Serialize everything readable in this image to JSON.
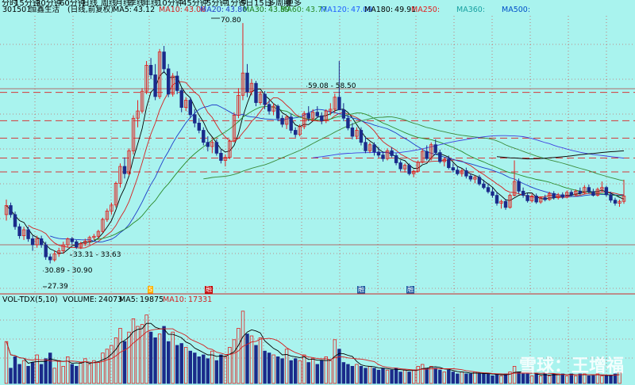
{
  "periods": [
    "分时",
    "15分钟",
    "30分钟",
    "60分钟",
    "日线",
    "周线",
    "月线",
    "季线",
    "年线",
    "10分钟",
    "45分钟",
    "5分钟",
    "1分钟",
    "5日",
    "15日",
    "多周期",
    "更多"
  ],
  "price_panel": {
    "stock_code": "301501",
    "stock_name": "恒鑫生活",
    "adjust_mode": "(日线,前复权)",
    "ma_items": [
      {
        "label": "MA5:",
        "value": "43.12",
        "color": "#000000"
      },
      {
        "label": "MA10:",
        "value": "43.06",
        "color": "#d42020"
      },
      {
        "label": "MA20:",
        "value": "43.80",
        "color": "#1e3cc8"
      },
      {
        "label": "MA30:",
        "value": "43.89",
        "color": "#1a7a1a"
      },
      {
        "label": "MA60:",
        "value": "43.77",
        "color": "#2a8a2a"
      },
      {
        "label": "MA120:",
        "value": "47.09",
        "color": "#2060ff"
      },
      {
        "label": "MA180:",
        "value": "49.91",
        "color": "#000000"
      },
      {
        "label": "MA250:",
        "value": "",
        "color": "#e02020"
      },
      {
        "label": "MA360:",
        "value": "",
        "color": "#16a0a0"
      },
      {
        "label": "MA500:",
        "value": "",
        "color": "#0050c8"
      }
    ],
    "annotations": [
      {
        "text": "70.80"
      },
      {
        "text": "59.08 - 58.50"
      },
      {
        "text": "33.31 - 33.63"
      },
      {
        "text": "30.89 - 30.90"
      },
      {
        "text": "27.39"
      }
    ],
    "event_markers": [
      {
        "text": "S",
        "color": "#ffb000"
      },
      {
        "text": "融",
        "color": "#c00000"
      },
      {
        "text": "融",
        "color": "#1a5aa0"
      },
      {
        "text": "融",
        "color": "#1a5aa0"
      }
    ]
  },
  "volume_panel": {
    "indicator": "VOL-TDX(5,10)",
    "items": [
      {
        "label": "VOLUME:",
        "value": "24073",
        "color": "#000000"
      },
      {
        "label": "MA5:",
        "value": "19875",
        "color": "#000000"
      },
      {
        "label": "MA10:",
        "value": "17331",
        "color": "#d42020"
      }
    ]
  },
  "watermark": "雪球：王增福",
  "colors": {
    "background": "#a9f3ee",
    "up": "#e0201e",
    "down": "#1a2b8a",
    "grid": "#d02828"
  },
  "chart_data": {
    "type": "candlestick",
    "price_range": [
      26.5,
      72
    ],
    "price_levels_dashed": [
      59.3,
      54.6,
      51.7,
      48.4,
      46.1
    ],
    "price_levels_solid": [
      59.9,
      34.0
    ],
    "ohlc": [
      [
        39,
        41.5,
        38,
        40.5
      ],
      [
        40.5,
        41,
        38.5,
        39
      ],
      [
        39,
        39.5,
        36.5,
        37
      ],
      [
        37,
        37.5,
        35,
        35.5
      ],
      [
        35.5,
        37,
        34.8,
        36.5
      ],
      [
        36.5,
        37,
        34.5,
        35
      ],
      [
        35,
        35.5,
        33,
        34
      ],
      [
        34,
        35.5,
        33.5,
        35
      ],
      [
        35,
        35.5,
        33.5,
        34
      ],
      [
        34,
        34.5,
        31.5,
        32
      ],
      [
        32,
        32.5,
        30.9,
        31.5
      ],
      [
        31.5,
        33,
        31.2,
        32.5
      ],
      [
        32.5,
        33.5,
        32,
        33
      ],
      [
        33,
        34.5,
        32.5,
        34
      ],
      [
        34,
        35.2,
        33.5,
        35
      ],
      [
        35,
        35.3,
        34,
        34.5
      ],
      [
        34.5,
        34.8,
        33.31,
        33.63
      ],
      [
        33.6,
        34.5,
        33.3,
        34.2
      ],
      [
        34.2,
        35,
        33.8,
        34.6
      ],
      [
        34.6,
        35.5,
        34,
        35.2
      ],
      [
        35.2,
        35.8,
        34.8,
        35.4
      ],
      [
        35.4,
        36.5,
        35,
        36.2
      ],
      [
        36.2,
        38.5,
        36,
        38.2
      ],
      [
        38.2,
        40,
        37.8,
        39.6
      ],
      [
        39.6,
        41,
        39,
        40.6
      ],
      [
        40.6,
        44.5,
        40.2,
        44.2
      ],
      [
        44.2,
        47.5,
        43.5,
        47
      ],
      [
        47,
        48.5,
        45,
        45.8
      ],
      [
        45.8,
        50,
        45.5,
        49.6
      ],
      [
        49.6,
        55.5,
        49,
        55
      ],
      [
        55,
        58,
        53.5,
        56.2
      ],
      [
        56.2,
        60,
        55.8,
        59.5
      ],
      [
        59.5,
        64.5,
        59,
        63.8
      ],
      [
        63.8,
        65,
        61.5,
        62.2
      ],
      [
        62.2,
        64,
        58,
        58.6
      ],
      [
        58.6,
        66.5,
        58.2,
        66
      ],
      [
        66,
        67,
        62.5,
        63.2
      ],
      [
        63.2,
        64,
        58.5,
        59
      ],
      [
        59,
        62.5,
        58.6,
        62
      ],
      [
        62,
        62.8,
        59,
        59.6
      ],
      [
        59.6,
        60,
        56,
        56.8
      ],
      [
        56.8,
        58.5,
        56.2,
        58
      ],
      [
        58,
        58.5,
        55,
        55.6
      ],
      [
        55.6,
        56.5,
        53.5,
        54.2
      ],
      [
        54.2,
        55,
        52.5,
        53
      ],
      [
        53,
        53.5,
        50.5,
        51
      ],
      [
        51,
        52,
        49.5,
        50.3
      ],
      [
        50.3,
        51.5,
        49.2,
        51
      ],
      [
        51,
        51.5,
        48.8,
        49.2
      ],
      [
        49.2,
        49.8,
        47.5,
        48
      ],
      [
        48,
        49,
        47,
        48.5
      ],
      [
        48.5,
        51.5,
        48.2,
        51.2
      ],
      [
        51.2,
        56,
        51,
        55.5
      ],
      [
        55.5,
        60,
        55,
        58.8
      ],
      [
        58.8,
        70.8,
        58,
        62.5
      ],
      [
        62.5,
        64,
        58.5,
        59.4
      ],
      [
        59.4,
        61.5,
        58.8,
        60.8
      ],
      [
        60.8,
        61.2,
        57,
        57.6
      ],
      [
        57.6,
        59.5,
        57.2,
        59
      ],
      [
        59,
        59.5,
        56.5,
        57.3
      ],
      [
        57.3,
        58,
        55.6,
        56.2
      ],
      [
        56.2,
        57.5,
        55.5,
        57
      ],
      [
        57,
        57.3,
        54.5,
        55
      ],
      [
        55,
        55.5,
        53.5,
        54
      ],
      [
        54,
        55.5,
        53.2,
        55.2
      ],
      [
        55.2,
        55.8,
        52.5,
        53
      ],
      [
        53,
        53.5,
        51.8,
        52.3
      ],
      [
        52.3,
        54,
        52,
        53.6
      ],
      [
        53.6,
        56.2,
        53.2,
        55.8
      ],
      [
        55.8,
        57,
        54.5,
        55
      ],
      [
        55,
        56.5,
        54.5,
        56
      ],
      [
        56,
        57,
        55,
        55.4
      ],
      [
        55.4,
        56,
        54,
        54.6
      ],
      [
        54.6,
        56.5,
        54.2,
        56.2
      ],
      [
        56.2,
        57.5,
        55.5,
        56.5
      ],
      [
        56.5,
        59.08,
        55.8,
        58.5
      ],
      [
        58.5,
        64.5,
        58,
        56.4
      ],
      [
        56.4,
        57.5,
        54.5,
        55
      ],
      [
        55,
        55.5,
        53,
        53.4
      ],
      [
        53.4,
        54.2,
        51.5,
        52
      ],
      [
        52,
        53.5,
        51.5,
        53
      ],
      [
        53,
        53.5,
        50.5,
        51
      ],
      [
        51,
        52,
        49.2,
        49.6
      ],
      [
        49.6,
        51,
        49.2,
        50.6
      ],
      [
        50.6,
        51,
        48.8,
        49.4
      ],
      [
        49.4,
        50.2,
        48.5,
        48.9
      ],
      [
        48.9,
        49.5,
        47.8,
        48.3
      ],
      [
        48.3,
        50,
        48,
        49.6
      ],
      [
        49.6,
        50.2,
        48.5,
        48.8
      ],
      [
        48.8,
        49.2,
        47.2,
        47.6
      ],
      [
        47.6,
        48,
        46.2,
        46.6
      ],
      [
        46.6,
        47.5,
        46,
        47.2
      ],
      [
        47.2,
        47.5,
        45.5,
        45.8
      ],
      [
        45.8,
        46.5,
        45.2,
        46.2
      ],
      [
        46.2,
        48,
        46,
        47.7
      ],
      [
        47.7,
        50,
        47.5,
        49.5
      ],
      [
        49.5,
        50.5,
        48,
        48.3
      ],
      [
        48.3,
        51,
        48,
        50.6
      ],
      [
        50.6,
        51.5,
        49,
        49.3
      ],
      [
        49.3,
        49.8,
        47.5,
        47.8
      ],
      [
        47.8,
        48.5,
        47,
        48.2
      ],
      [
        48.2,
        48.8,
        46.5,
        46.8
      ],
      [
        46.8,
        47.5,
        46,
        46.4
      ],
      [
        46.4,
        47,
        45.5,
        45.8
      ],
      [
        45.8,
        46.6,
        45.3,
        46.3
      ],
      [
        46.3,
        46.8,
        45,
        45.4
      ],
      [
        45.4,
        45.8,
        44.5,
        44.9
      ],
      [
        44.9,
        45.5,
        44.2,
        45.2
      ],
      [
        45.2,
        45.6,
        43.8,
        44.1
      ],
      [
        44.1,
        44.8,
        43.2,
        43.5
      ],
      [
        43.5,
        44.2,
        42.5,
        42.8
      ],
      [
        42.8,
        43.5,
        41.8,
        42.2
      ],
      [
        42.2,
        42.8,
        40.5,
        40.9
      ],
      [
        40.9,
        41.5,
        40,
        41.2
      ],
      [
        41.2,
        41.6,
        39.8,
        40.2
      ],
      [
        40.2,
        42.5,
        40,
        42.2
      ],
      [
        42.2,
        48,
        42,
        44.5
      ],
      [
        44.5,
        45,
        42.5,
        42.9
      ],
      [
        42.9,
        43.5,
        41.8,
        42.2
      ],
      [
        42.2,
        42.6,
        41,
        41.3
      ],
      [
        41.3,
        42.5,
        41,
        42.1
      ],
      [
        42.1,
        42.5,
        40.8,
        41.1
      ],
      [
        41.1,
        42,
        40.8,
        41.8
      ],
      [
        41.8,
        42.3,
        41.2,
        41.5
      ],
      [
        41.5,
        42.8,
        41.3,
        42.5
      ],
      [
        42.5,
        42.9,
        41.5,
        41.8
      ],
      [
        41.8,
        42.6,
        41.5,
        42.3
      ],
      [
        42.3,
        42.7,
        41.6,
        41.9
      ],
      [
        41.9,
        43,
        41.7,
        42.7
      ],
      [
        42.7,
        43.1,
        42,
        42.3
      ],
      [
        42.3,
        43.2,
        42,
        42.9
      ],
      [
        42.9,
        43.5,
        42.3,
        42.6
      ],
      [
        42.6,
        43.9,
        42.4,
        43.5
      ],
      [
        43.5,
        44,
        42.5,
        42.8
      ],
      [
        42.8,
        43.3,
        42,
        42.2
      ],
      [
        42.2,
        43.5,
        42,
        43.2
      ],
      [
        43.2,
        44.5,
        42.8,
        43.5
      ],
      [
        43.5,
        43.8,
        42,
        42.3
      ],
      [
        42.3,
        42.8,
        41,
        41.4
      ],
      [
        41.4,
        41.8,
        40.5,
        40.9
      ],
      [
        40.9,
        41.5,
        40.3,
        41.2
      ],
      [
        41.2,
        44.8,
        40.8,
        42.1
      ]
    ],
    "volume": [
      22,
      8,
      14,
      10,
      12,
      9,
      11,
      15,
      10,
      13,
      16,
      8,
      12,
      9,
      14,
      10,
      9,
      11,
      13,
      10,
      12,
      11,
      16,
      18,
      20,
      24,
      29,
      22,
      27,
      34,
      30,
      31,
      36,
      27,
      24,
      26,
      30,
      22,
      27,
      20,
      21,
      19,
      17,
      16,
      14,
      15,
      13,
      17,
      12,
      15,
      14,
      19,
      23,
      29,
      38,
      26,
      25,
      20,
      24,
      17,
      16,
      15,
      14,
      13,
      18,
      12,
      13,
      12,
      15,
      11,
      13,
      10,
      12,
      14,
      12,
      23,
      18,
      11,
      10,
      9,
      10,
      9,
      8,
      9,
      8,
      7,
      8,
      7,
      7,
      8,
      6,
      7,
      6,
      7,
      9,
      10,
      8,
      9,
      8,
      7,
      6,
      7,
      6,
      5,
      6,
      5,
      5,
      6,
      5,
      5,
      5,
      4,
      5,
      4,
      5,
      6,
      9,
      6,
      5,
      5,
      4,
      5,
      4,
      5,
      4,
      5,
      5,
      5,
      4,
      5,
      4,
      5,
      5,
      4,
      4,
      5,
      4,
      4,
      4,
      5,
      6
    ]
  }
}
